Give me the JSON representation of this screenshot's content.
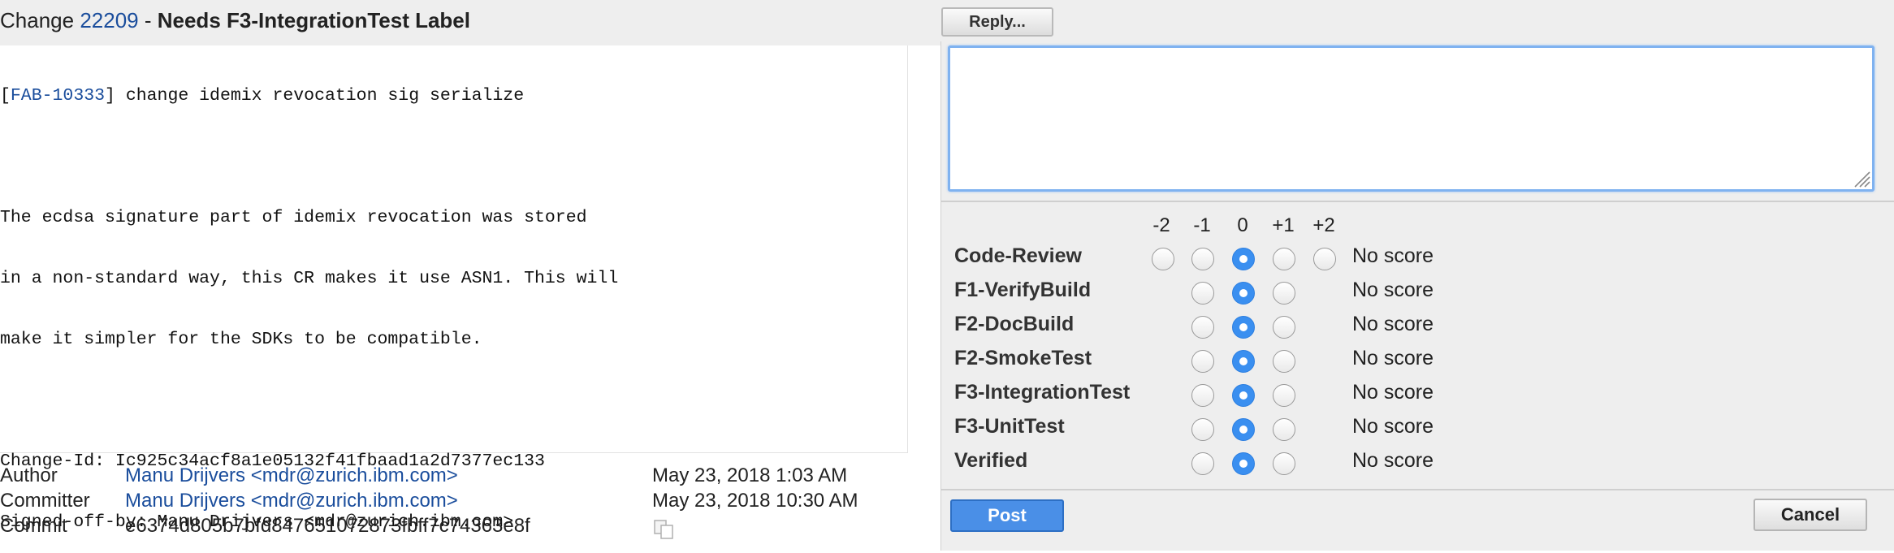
{
  "header": {
    "change_prefix": "Change ",
    "change_number": "22209",
    "separator": " - ",
    "status": "Needs F3-IntegrationTest Label",
    "reply_label": "Reply..."
  },
  "commit_message": {
    "line1_open": "[",
    "bug_id": "FAB-10333",
    "line1_rest": "] change idemix revocation sig serialize",
    "lines": [
      "",
      "The ecdsa signature part of idemix revocation was stored",
      "in a non-standard way, this CR makes it use ASN1. This will",
      "make it simpler for the SDKs to be compatible.",
      "",
      "Change-Id: Ic925c34acf8a1e05132f41fbaad1a2d7377ec133",
      "Signed-off-by: Manu Drijvers <mdr@zurich.ibm.com>"
    ]
  },
  "commit_info": {
    "author_label": "Author",
    "author_value": "Manu Drijvers <mdr@zurich.ibm.com>",
    "author_date": "May 23, 2018 1:03 AM",
    "committer_label": "Committer",
    "committer_value": "Manu Drijvers <mdr@zurich.ibm.com>",
    "committer_date": "May 23, 2018 10:30 AM",
    "commit_label": "Commit",
    "commit_value": "e6374d805b7bfd847651072873fbff7c74363e8f"
  },
  "reply": {
    "textarea_value": "",
    "score_headers": [
      "-2",
      "-1",
      "0",
      "+1",
      "+2"
    ],
    "labels": [
      {
        "name": "Code-Review",
        "min": -2,
        "max": 2,
        "selected": 0,
        "score_text": "No score"
      },
      {
        "name": "F1-VerifyBuild",
        "min": -1,
        "max": 1,
        "selected": 0,
        "score_text": "No score"
      },
      {
        "name": "F2-DocBuild",
        "min": -1,
        "max": 1,
        "selected": 0,
        "score_text": "No score"
      },
      {
        "name": "F2-SmokeTest",
        "min": -1,
        "max": 1,
        "selected": 0,
        "score_text": "No score"
      },
      {
        "name": "F3-IntegrationTest",
        "min": -1,
        "max": 1,
        "selected": 0,
        "score_text": "No score"
      },
      {
        "name": "F3-UnitTest",
        "min": -1,
        "max": 1,
        "selected": 0,
        "score_text": "No score"
      },
      {
        "name": "Verified",
        "min": -1,
        "max": 1,
        "selected": 0,
        "score_text": "No score"
      }
    ],
    "post_label": "Post",
    "cancel_label": "Cancel"
  },
  "colors": {
    "link": "#1a4d9c",
    "accent": "#4a8fe7",
    "panel_background": "#eeeeee"
  }
}
